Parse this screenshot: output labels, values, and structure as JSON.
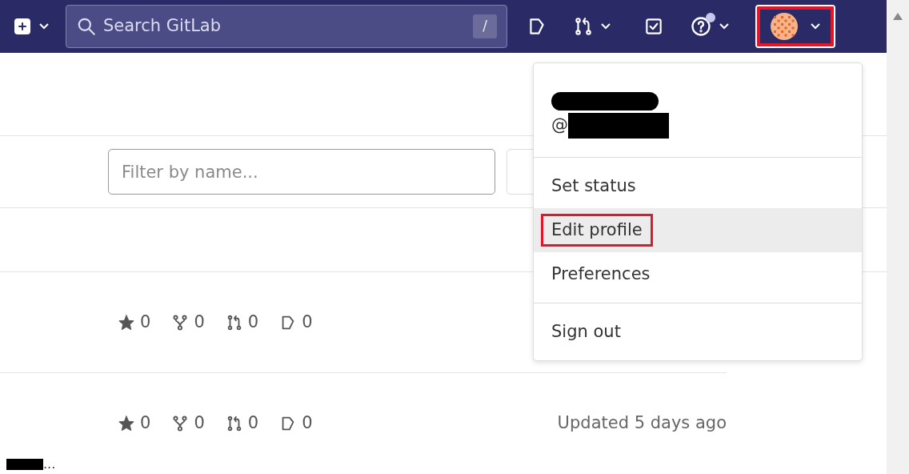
{
  "navbar": {
    "search": {
      "placeholder": "Search GitLab",
      "shortcut": "/"
    },
    "help_notification": true,
    "user_menu": {
      "highlighted": true,
      "expanded": true
    }
  },
  "user_dropdown": {
    "handle_prefix": "@",
    "groups": [
      {
        "items": [
          {
            "label": "Set status",
            "hovered": false,
            "highlighted": false
          },
          {
            "label": "Edit profile",
            "hovered": true,
            "highlighted": true
          },
          {
            "label": "Preferences",
            "hovered": false,
            "highlighted": false
          }
        ]
      },
      {
        "items": [
          {
            "label": "Sign out",
            "hovered": false,
            "highlighted": false
          }
        ]
      }
    ]
  },
  "filter": {
    "placeholder": "Filter by name..."
  },
  "projects": [
    {
      "stats": [
        {
          "kind": "star",
          "count": "0"
        },
        {
          "kind": "fork",
          "count": "0"
        },
        {
          "kind": "merge",
          "count": "0"
        },
        {
          "kind": "issue",
          "count": "0"
        }
      ]
    },
    {
      "name_end": "...",
      "stats": [
        {
          "kind": "star",
          "count": "0"
        },
        {
          "kind": "fork",
          "count": "0"
        },
        {
          "kind": "merge",
          "count": "0"
        },
        {
          "kind": "issue",
          "count": "0"
        }
      ],
      "updated": "Updated 5 days ago"
    }
  ]
}
